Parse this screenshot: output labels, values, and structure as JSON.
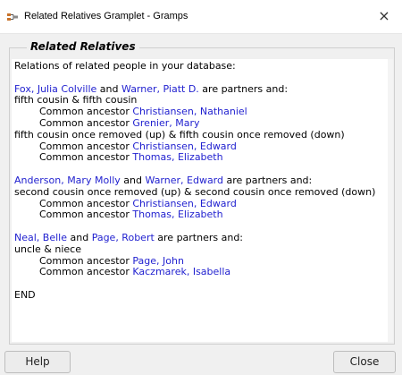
{
  "window": {
    "title": "Related Relatives Gramplet - Gramps",
    "close_glyph": "×"
  },
  "frame": {
    "legend": "Related Relatives"
  },
  "report": {
    "intro": "Relations of related people in your database:",
    "groups": [
      {
        "person1": "Fox, Julia Colville",
        "conjunction": " and ",
        "person2": "Warner, Piatt D.",
        "suffix": " are partners and:",
        "relations": [
          {
            "relationship": "fifth cousin & fifth cousin",
            "ancestors": [
              {
                "prefix": "Common ancestor ",
                "name": "Christiansen, Nathaniel"
              },
              {
                "prefix": "Common ancestor ",
                "name": "Grenier, Mary"
              }
            ]
          },
          {
            "relationship": "fifth cousin once removed (up) & fifth cousin once removed (down)",
            "ancestors": [
              {
                "prefix": "Common ancestor ",
                "name": "Christiansen, Edward"
              },
              {
                "prefix": "Common ancestor ",
                "name": "Thomas, Elizabeth"
              }
            ]
          }
        ]
      },
      {
        "person1": "Anderson, Mary Molly",
        "conjunction": " and ",
        "person2": "Warner, Edward",
        "suffix": " are partners and:",
        "relations": [
          {
            "relationship": "second cousin once removed (up) & second cousin once removed (down)",
            "ancestors": [
              {
                "prefix": "Common ancestor ",
                "name": "Christiansen, Edward"
              },
              {
                "prefix": "Common ancestor ",
                "name": "Thomas, Elizabeth"
              }
            ]
          }
        ]
      },
      {
        "person1": "Neal, Belle",
        "conjunction": " and ",
        "person2": "Page, Robert",
        "suffix": " are partners and:",
        "relations": [
          {
            "relationship": "uncle & niece",
            "ancestors": [
              {
                "prefix": "Common ancestor ",
                "name": "Page, John"
              },
              {
                "prefix": "Common ancestor ",
                "name": "Kaczmarek, Isabella"
              }
            ]
          }
        ]
      }
    ],
    "end": "END"
  },
  "buttons": {
    "help": "Help",
    "close": "Close"
  },
  "colors": {
    "link": "#1f1fcf",
    "icon": "gramps-tree-icon"
  }
}
